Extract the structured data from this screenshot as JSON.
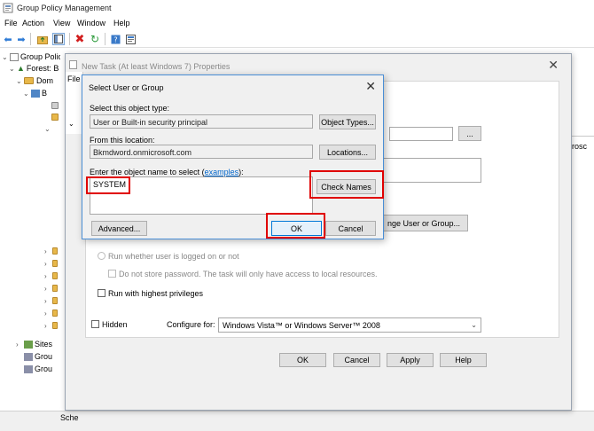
{
  "app": {
    "title": "Group Policy Management"
  },
  "menu": [
    "File",
    "Action",
    "View",
    "Window",
    "Help"
  ],
  "tree": {
    "root": "Group Policy",
    "forest": "Forest: B",
    "domains": "Dom",
    "domain_item": "B",
    "sites": "Sites",
    "group_modeling": "Grou",
    "group_results": "Grou"
  },
  "right_pane": {
    "item": "rosc"
  },
  "status": {
    "text": "Sche"
  },
  "props": {
    "title": "New Task (At least Windows 7) Properties",
    "side_tab": "File",
    "change_user_button": "nge User or Group...",
    "browse_button": "...",
    "run_whether_label": "Run whether user is logged on or not",
    "no_store_password_label": "Do not store password. The task will only have access to local resources.",
    "highest_priv_label": "Run with highest privileges",
    "hidden_label": "Hidden",
    "configure_for_label": "Configure for:",
    "configure_for_value": "Windows Vista™ or Windows Server™ 2008",
    "ok": "OK",
    "cancel": "Cancel",
    "apply": "Apply",
    "help": "Help"
  },
  "dialog": {
    "title": "Select User or Group",
    "object_type_label": "Select this object type:",
    "object_type_value": "User or Built-in security principal",
    "object_types_button": "Object Types...",
    "location_label": "From this location:",
    "location_value": "Bkmdword.onmicrosoft.com",
    "locations_button": "Locations...",
    "enter_name_label": "Enter the object name to select (",
    "examples_link": "examples",
    "enter_name_suffix": "):",
    "object_name_value": "SYSTEM",
    "check_names_button": "Check Names",
    "advanced_button": "Advanced...",
    "ok_button": "OK",
    "cancel_button": "Cancel"
  },
  "colors": {
    "highlight": "#e00000",
    "accent": "#4a8ed6",
    "link": "#0066cc"
  }
}
